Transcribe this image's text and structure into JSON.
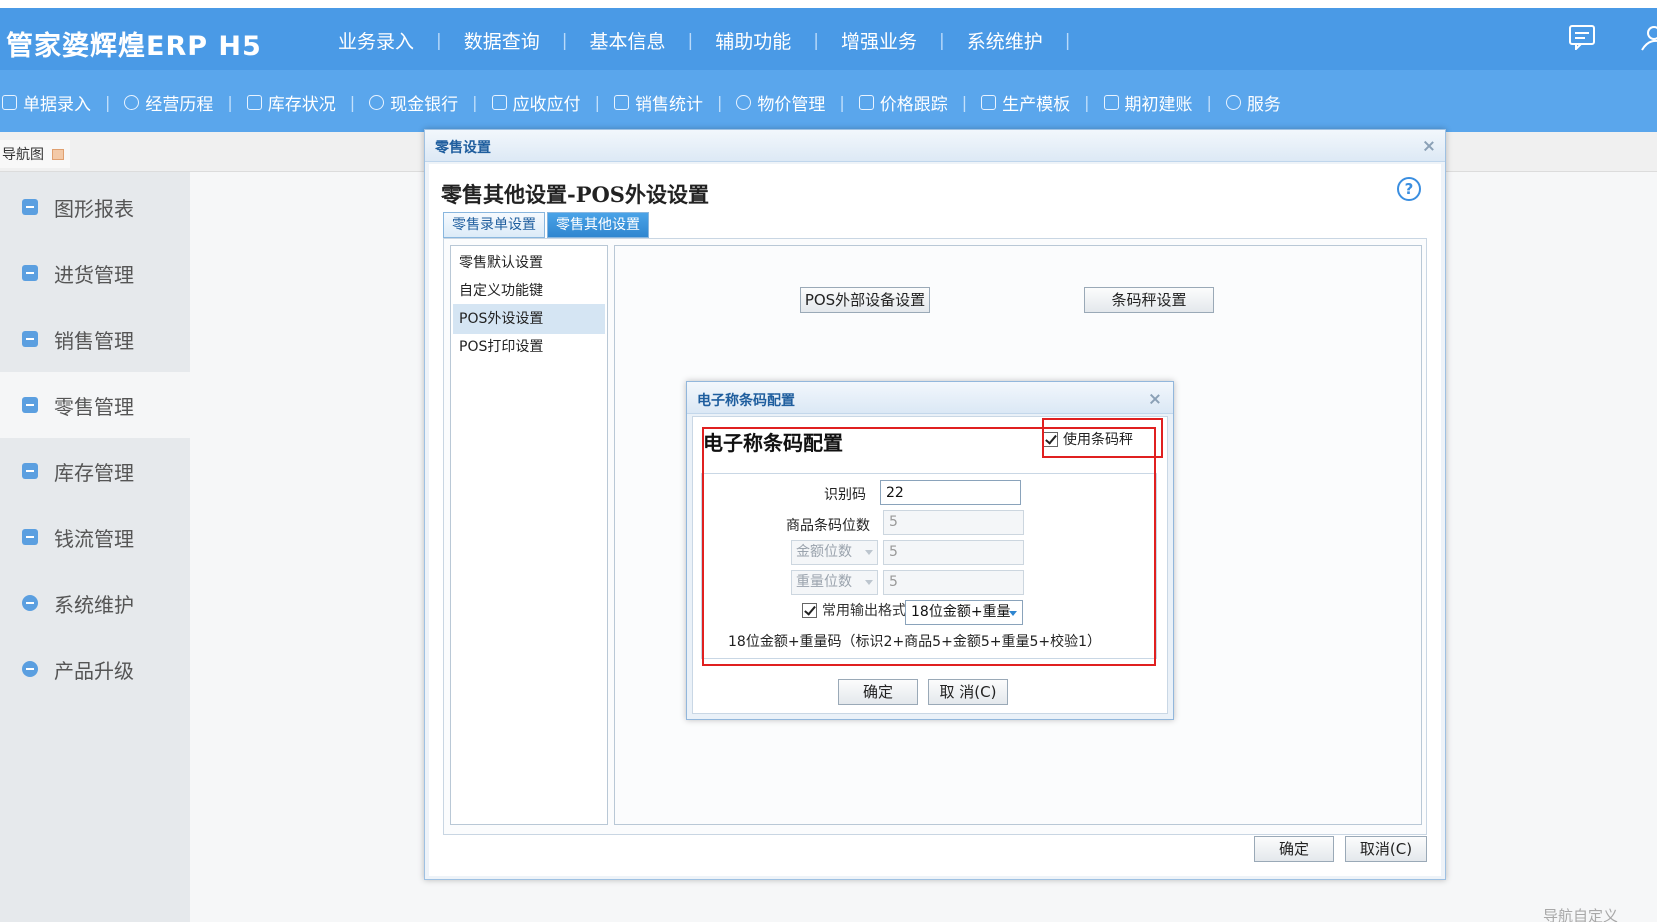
{
  "header": {
    "logo": "管家婆辉煌ERP H5",
    "main_menu": [
      "业务录入",
      "数据查询",
      "基本信息",
      "辅助功能",
      "增强业务",
      "系统维护"
    ],
    "sub_menu": [
      "单据录入",
      "经营历程",
      "库存状况",
      "现金银行",
      "应收应付",
      "销售统计",
      "物价管理",
      "价格跟踪",
      "生产模板",
      "期初建账",
      "服务"
    ]
  },
  "nav_tab": {
    "label": "导航图"
  },
  "sidebar": {
    "items": [
      "图形报表",
      "进货管理",
      "销售管理",
      "零售管理",
      "库存管理",
      "钱流管理",
      "系统维护",
      "产品升级"
    ],
    "active_index": 3
  },
  "nav_custom_label": "导航自定义",
  "dialog": {
    "title": "零售设置",
    "heading": "零售其他设置-POS外设设置",
    "help": "?",
    "tabs": [
      "零售录单设置",
      "零售其他设置"
    ],
    "active_tab": 1,
    "tree": [
      "零售默认设置",
      "自定义功能键",
      "POS外设设置",
      "POS打印设置"
    ],
    "selected_tree_index": 2,
    "pos_device_button": "POS外部设备设置",
    "barcode_scale_button": "条码秤设置",
    "ok_label": "确定",
    "cancel_label": "取消(C)"
  },
  "inner_dialog": {
    "title": "电子称条码配置",
    "heading": "电子称条码配置",
    "use_scale_label": "使用条码秤",
    "use_scale_checked": true,
    "fields": {
      "id_code_label": "识别码",
      "id_code_value": "22",
      "goods_digits_label": "商品条码位数",
      "goods_digits_value": "5",
      "amount_digits_label": "金额位数",
      "amount_digits_value": "5",
      "weight_digits_label": "重量位数",
      "weight_digits_value": "5",
      "common_format_label": "常用输出格式",
      "common_format_checked": true,
      "common_format_value": "18位金额+重量"
    },
    "format_description": "18位金额+重量码（标识2+商品5+金额5+重量5+校验1）",
    "ok_label": "确定",
    "cancel_label": "取 消(C)"
  },
  "colors": {
    "header_blue": "#4a9ae6",
    "subbar_blue": "#5aa6ec",
    "highlight_red": "#e02020",
    "active_tab_blue": "#2f86d0"
  }
}
